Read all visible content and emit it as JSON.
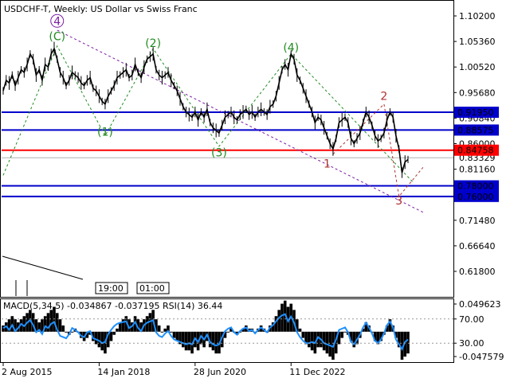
{
  "header": {
    "title": "USDCHF-T, Weekly:  US Dollar vs Swiss Franc",
    "indicator_label": "MACD(5,34,5) -0.034867 -0.037195 RSI(14) 36.44"
  },
  "colors": {
    "price": "#000000",
    "blue_level": "#0000cc",
    "red_level": "#ff0000",
    "green_wave": "#228b22",
    "purple_wave": "#7b1fa2",
    "red_wave": "#b03030",
    "macd": "#000000",
    "rsi": "#1e90ff"
  },
  "chart_data": {
    "type": "line",
    "y_ticks": [
      "1.10200",
      "1.05360",
      "1.00520",
      "0.95680",
      "0.90840",
      "0.86000",
      "0.81160",
      "0.76320",
      "0.71480",
      "0.66640",
      "0.61800"
    ],
    "x_ticks": [
      "2 Aug 2015",
      "14 Jan 2018",
      "28 Jun 2020",
      "11 Dec 2022"
    ],
    "levels": [
      {
        "price": 0.9195,
        "label": "0.91950",
        "kind": "blue"
      },
      {
        "price": 0.88575,
        "label": "0.88575",
        "kind": "blue"
      },
      {
        "price": 0.84758,
        "label": "0.84758",
        "kind": "red"
      },
      {
        "price": 0.78,
        "label": "0.78000",
        "kind": "blue"
      },
      {
        "price": 0.76,
        "label": "0.76000",
        "kind": "blue"
      }
    ],
    "current_price_label": "0.83329",
    "time_labels": [
      "19:00",
      "01:00"
    ],
    "waves": [
      {
        "label": "4",
        "circled": true,
        "color": "purple",
        "date_idx": 18,
        "price": 1.085
      },
      {
        "label": "(C)",
        "circled": false,
        "color": "green",
        "date_idx": 18,
        "price": 1.056
      },
      {
        "label": "(1)",
        "circled": false,
        "color": "green",
        "date_idx": 34,
        "price": 0.875
      },
      {
        "label": "(2)",
        "circled": false,
        "color": "green",
        "date_idx": 50,
        "price": 1.043
      },
      {
        "label": "(3)",
        "circled": false,
        "color": "green",
        "date_idx": 72,
        "price": 0.836
      },
      {
        "label": "(4)",
        "circled": false,
        "color": "green",
        "date_idx": 96,
        "price": 1.035
      },
      {
        "label": "1",
        "circled": false,
        "color": "red",
        "date_idx": 108,
        "price": 0.815
      },
      {
        "label": "2",
        "circled": false,
        "color": "red",
        "date_idx": 127,
        "price": 0.943
      },
      {
        "label": "3",
        "circled": false,
        "color": "red",
        "date_idx": 132,
        "price": 0.745
      }
    ],
    "series": [
      {
        "name": "Close",
        "values": [
          0.96,
          0.98,
          0.975,
          0.99,
          0.97,
          0.985,
          1.0,
          0.995,
          1.01,
          1.03,
          1.02,
          0.99,
          1.0,
          0.98,
          1.01,
          1.005,
          1.03,
          1.04,
          1.02,
          0.995,
          0.985,
          0.97,
          0.98,
          0.995,
          0.99,
          0.985,
          0.975,
          0.97,
          0.98,
          0.985,
          0.965,
          0.96,
          0.95,
          0.94,
          0.935,
          0.95,
          0.96,
          0.97,
          0.985,
          0.99,
          0.995,
          1.0,
          0.985,
          0.99,
          1.01,
          0.995,
          0.985,
          1.005,
          1.02,
          1.025,
          1.03,
          1.0,
          0.99,
          0.985,
          0.99,
          0.995,
          0.98,
          0.97,
          0.96,
          0.945,
          0.93,
          0.92,
          0.915,
          0.91,
          0.92,
          0.905,
          0.92,
          0.91,
          0.925,
          0.9,
          0.89,
          0.885,
          0.88,
          0.895,
          0.91,
          0.915,
          0.92,
          0.91,
          0.905,
          0.915,
          0.92,
          0.925,
          0.915,
          0.92,
          0.91,
          0.92,
          0.925,
          0.92,
          0.915,
          0.93,
          0.935,
          0.95,
          0.975,
          1.0,
          1.01,
          1.0,
          1.03,
          1.02,
          0.99,
          0.98,
          0.965,
          0.95,
          0.935,
          0.92,
          0.9,
          0.91,
          0.905,
          0.89,
          0.875,
          0.86,
          0.85,
          0.87,
          0.9,
          0.905,
          0.91,
          0.9,
          0.87,
          0.86,
          0.87,
          0.88,
          0.9,
          0.92,
          0.91,
          0.895,
          0.875,
          0.865,
          0.87,
          0.88,
          0.905,
          0.92,
          0.91,
          0.875,
          0.85,
          0.805,
          0.825,
          0.83
        ]
      },
      {
        "name": "MACD",
        "values": [
          0.01,
          0.015,
          0.02,
          0.025,
          0.02,
          0.015,
          0.02,
          0.025,
          0.03,
          0.035,
          0.03,
          0.02,
          0.015,
          0.02,
          0.025,
          0.03,
          0.035,
          0.04,
          0.03,
          0.02,
          0.01,
          0.0,
          -0.005,
          0.0,
          0.005,
          0.0,
          -0.01,
          -0.015,
          -0.01,
          -0.005,
          -0.015,
          -0.02,
          -0.025,
          -0.03,
          -0.035,
          -0.025,
          -0.015,
          -0.005,
          0.005,
          0.015,
          0.02,
          0.025,
          0.02,
          0.015,
          0.025,
          0.02,
          0.015,
          0.02,
          0.025,
          0.03,
          0.035,
          0.02,
          0.01,
          0.0,
          0.005,
          0.01,
          0.0,
          -0.01,
          -0.015,
          -0.02,
          -0.025,
          -0.03,
          -0.03,
          -0.035,
          -0.025,
          -0.03,
          -0.02,
          -0.025,
          -0.015,
          -0.025,
          -0.03,
          -0.035,
          -0.035,
          -0.025,
          -0.01,
          0.0,
          0.005,
          0.0,
          -0.005,
          0.0,
          0.005,
          0.01,
          0.005,
          0.005,
          0.0,
          0.005,
          0.01,
          0.005,
          0.0,
          0.01,
          0.015,
          0.025,
          0.035,
          0.045,
          0.05,
          0.04,
          0.045,
          0.035,
          0.02,
          0.005,
          -0.01,
          -0.02,
          -0.025,
          -0.03,
          -0.035,
          -0.025,
          -0.025,
          -0.03,
          -0.035,
          -0.04,
          -0.045,
          -0.035,
          -0.02,
          -0.01,
          0.0,
          -0.005,
          -0.015,
          -0.025,
          -0.02,
          -0.01,
          0.005,
          0.015,
          0.01,
          0.0,
          -0.015,
          -0.02,
          -0.015,
          -0.005,
          0.01,
          0.02,
          0.01,
          -0.01,
          -0.025,
          -0.045,
          -0.04,
          -0.035
        ]
      },
      {
        "name": "RSI",
        "values": [
          55,
          58,
          52,
          60,
          50,
          55,
          62,
          58,
          64,
          68,
          60,
          48,
          52,
          45,
          58,
          55,
          62,
          65,
          52,
          42,
          40,
          38,
          45,
          55,
          52,
          48,
          42,
          40,
          48,
          50,
          38,
          36,
          34,
          30,
          32,
          45,
          52,
          58,
          62,
          64,
          65,
          66,
          55,
          58,
          65,
          55,
          50,
          60,
          64,
          66,
          68,
          48,
          42,
          40,
          46,
          50,
          42,
          36,
          34,
          32,
          30,
          28,
          30,
          28,
          38,
          32,
          42,
          36,
          44,
          32,
          28,
          26,
          28,
          40,
          50,
          54,
          56,
          48,
          44,
          50,
          54,
          56,
          50,
          52,
          46,
          52,
          56,
          52,
          48,
          56,
          60,
          66,
          72,
          76,
          78,
          66,
          74,
          64,
          48,
          40,
          34,
          30,
          30,
          32,
          30,
          40,
          36,
          30,
          28,
          26,
          24,
          36,
          52,
          54,
          56,
          48,
          32,
          28,
          36,
          44,
          56,
          64,
          56,
          46,
          34,
          30,
          36,
          46,
          60,
          66,
          56,
          36,
          28,
          20,
          32,
          36
        ]
      }
    ]
  }
}
